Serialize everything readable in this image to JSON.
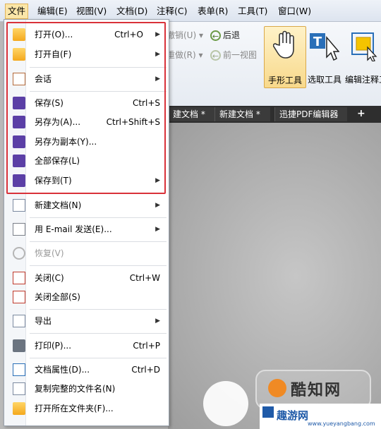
{
  "menubar": {
    "items": [
      "文件",
      "编辑(E)",
      "视图(V)",
      "文档(D)",
      "注释(C)",
      "表单(R)",
      "工具(T)",
      "窗口(W)"
    ]
  },
  "toolbar": {
    "undo": "撤销(U)",
    "back": "后退",
    "redo": "重做(R)",
    "prev_view": "前一视图",
    "hand_tool": "手形工具",
    "select_tool": "选取工具",
    "edit_annot_tool": "编辑注释工"
  },
  "tabs": [
    "建文档 *",
    "新建文档 *",
    "迅捷PDF编辑器",
    "+"
  ],
  "file_menu": {
    "open": {
      "label": "打开(O)...",
      "shortcut": "Ctrl+O"
    },
    "open_from": {
      "label": "打开自(F)"
    },
    "session": {
      "label": "会话"
    },
    "save": {
      "label": "保存(S)",
      "shortcut": "Ctrl+S"
    },
    "save_as": {
      "label": "另存为(A)...",
      "shortcut": "Ctrl+Shift+S"
    },
    "save_copy": {
      "label": "另存为副本(Y)..."
    },
    "save_all": {
      "label": "全部保存(L)"
    },
    "save_to": {
      "label": "保存到(T)"
    },
    "new_doc": {
      "label": "新建文档(N)"
    },
    "email": {
      "label": "用 E-mail 发送(E)..."
    },
    "restore": {
      "label": "恢复(V)"
    },
    "close": {
      "label": "关闭(C)",
      "shortcut": "Ctrl+W"
    },
    "close_all": {
      "label": "关闭全部(S)"
    },
    "export": {
      "label": "导出"
    },
    "print": {
      "label": "打印(P)...",
      "shortcut": "Ctrl+P"
    },
    "properties": {
      "label": "文档属性(D)...",
      "shortcut": "Ctrl+D"
    },
    "copy_filename": {
      "label": "复制完整的文件名(N)"
    },
    "open_folder": {
      "label": "打开所在文件夹(F)..."
    }
  },
  "watermark": {
    "brand": "酷知网",
    "site": "趣游网",
    "url": "www.yueyangbang.com"
  },
  "colors": {
    "highlight_border": "#d9323a",
    "menu_active": "#fbe6a8",
    "tab_bar": "#2e2e2e"
  }
}
